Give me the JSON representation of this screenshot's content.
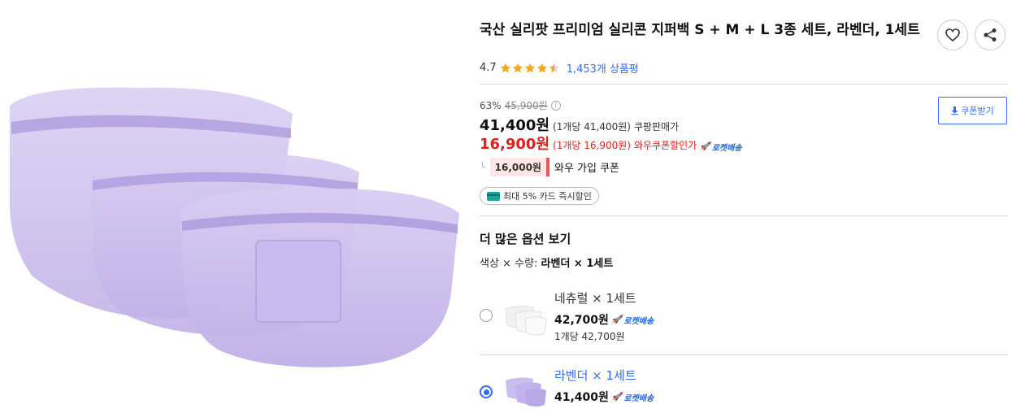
{
  "product": {
    "title": "국산 실리팟 프리미엄 실리콘 지퍼백 S + M + L 3종 세트, 라벤더, 1세트",
    "rating": "4.7",
    "rating_stars": 4.5,
    "review_count": "1,453개 상품평"
  },
  "pricing": {
    "discount_rate": "63%",
    "original_price": "45,900원",
    "coupang_price": "41,400원",
    "coupang_unit": "(1개당 41,400원)",
    "coupang_label": "쿠팡판매가",
    "wow_price": "16,900원",
    "wow_unit": "(1개당 16,900원)",
    "wow_label": "와우쿠폰할인가",
    "rocket_label": "로켓배송",
    "join_coupon_amount": "16,000원",
    "join_coupon_label": "와우 가입 쿠폰",
    "card_badge": "최대 5% 카드 즉시할인",
    "coupon_button": "쿠폰받기"
  },
  "options": {
    "title": "더 많은 옵션 보기",
    "selection_prefix": "색상 × 수량:",
    "selection_value": "라벤더 × 1세트",
    "items": [
      {
        "name": "네츄럴 × 1세트",
        "price": "42,700원",
        "rocket": "로켓배송",
        "unit_price": "1개당 42,700원",
        "selected": false
      },
      {
        "name": "라벤더 × 1세트",
        "price": "41,400원",
        "rocket": "로켓배송",
        "selected": true
      }
    ]
  },
  "colors": {
    "accent_blue": "#346aff",
    "sale_red": "#e0201a",
    "star": "#f5a623",
    "lavender": "#c8b8ec"
  }
}
